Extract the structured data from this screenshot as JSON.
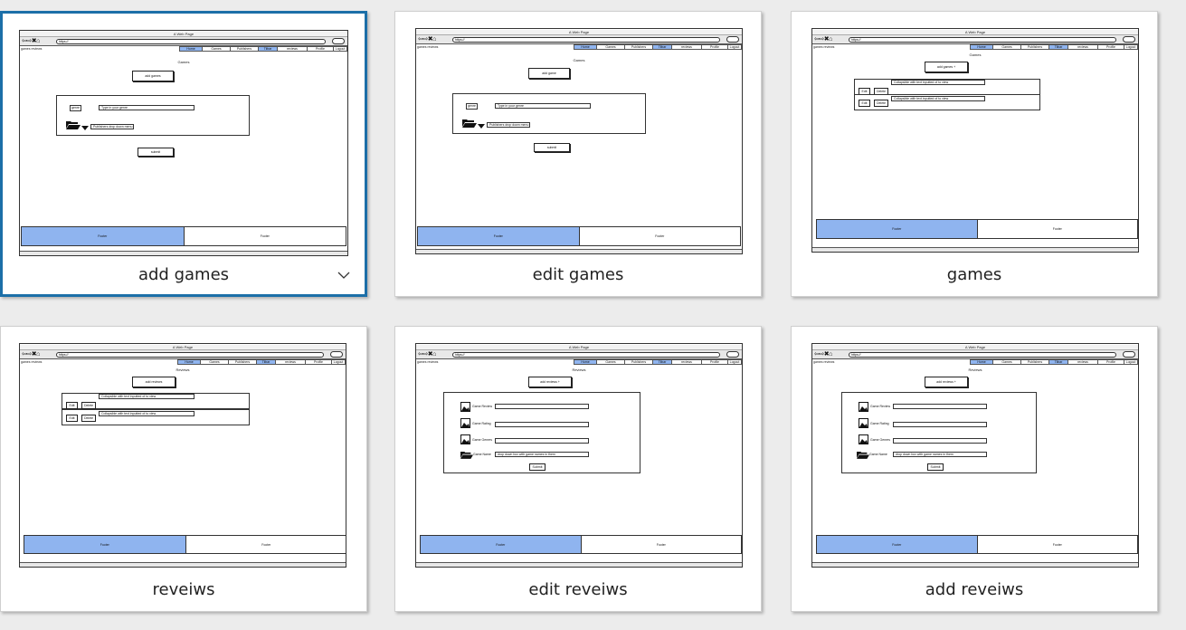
{
  "colors": {
    "selected_border": "#1c6fa8",
    "nav_active": "#8fb4ef",
    "footer_left": "#8fb4ef",
    "canvas": "#ececec"
  },
  "icons": [
    "back-arrow-icon",
    "forward-arrow-icon",
    "close-icon",
    "home-icon",
    "folder-icon",
    "dropdown-triangle-icon",
    "image-icon",
    "chevron-down-icon"
  ],
  "browser": {
    "title": "A Web Page",
    "url": "https://",
    "site_name": "games reviews",
    "nav": [
      "Home",
      "Games",
      "Publishers",
      "Tilbar",
      "reviews",
      "Profile",
      "Logout"
    ]
  },
  "footer": {
    "left": "Footer",
    "right": "Footer"
  },
  "cards": [
    {
      "label": "add games",
      "heading": "Games",
      "top_button": "add games",
      "form": {
        "genre_label": "genre",
        "genre_input": "Type in your genre",
        "dropdown": "Publishers drop down menu"
      },
      "submit": "submit"
    },
    {
      "label": "edit games",
      "heading": "Games",
      "top_button": "add game",
      "form": {
        "genre_label": "genre",
        "genre_input": "Type in your genre",
        "dropdown": "Publishers drop down menu"
      },
      "submit": "submit"
    },
    {
      "label": "games",
      "heading": "Games",
      "top_button": "add games +",
      "rows": [
        {
          "edit": "Edit",
          "delete": "Delete",
          "text": "Collapsible with text inputted of to view"
        },
        {
          "edit": "Edit",
          "delete": "Delete",
          "text": "Collapsible with text inputted of to view"
        }
      ]
    },
    {
      "label": "reveiws",
      "heading": "Reviews",
      "top_button": "add reviews",
      "rows": [
        {
          "edit": "Edit",
          "delete": "Delete",
          "text": "Collapsible with text inputted of to view"
        },
        {
          "edit": "Edit",
          "delete": "Delete",
          "text": "Collapsible with text inputted of to view"
        }
      ]
    },
    {
      "label": "edit reveiws",
      "heading": "Reviews",
      "top_button": "add reviews +",
      "fields": [
        "Game Review",
        "Game Rating",
        "Game Genres",
        "Game Name"
      ],
      "dropdown": "drop down box with game names in them",
      "submit": "Submit"
    },
    {
      "label": "add reveiws",
      "heading": "Reviews",
      "top_button": "add reviews +",
      "fields": [
        "Game Review",
        "Game Rating",
        "Game Genres",
        "Game Name"
      ],
      "dropdown": "drop down box with game names in them",
      "submit": "Submit"
    }
  ]
}
